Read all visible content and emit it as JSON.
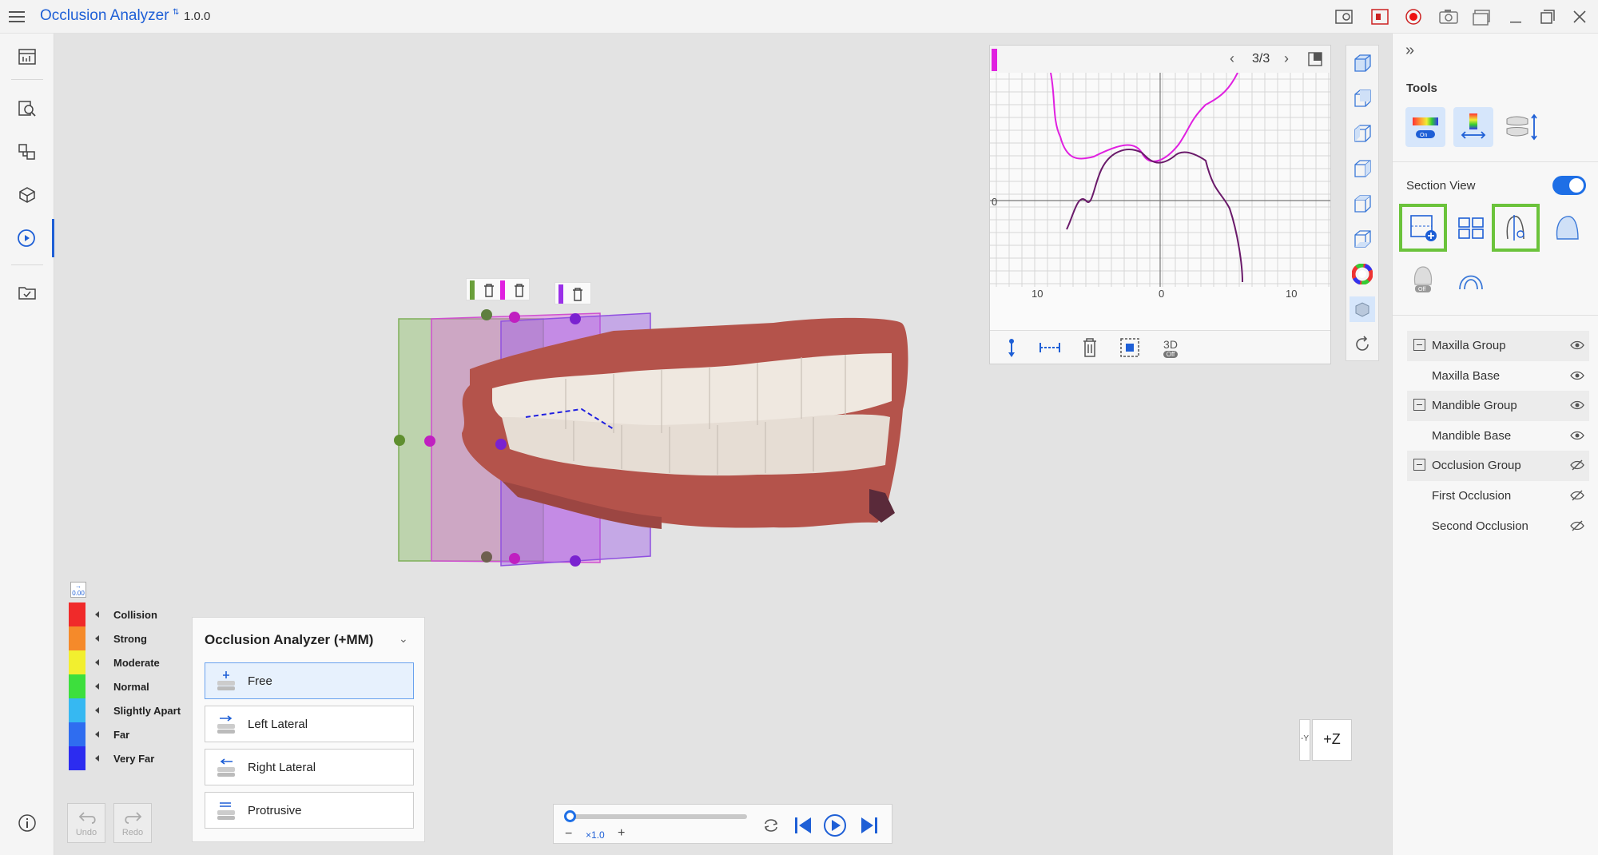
{
  "app": {
    "title": "Occlusion Analyzer",
    "version": "1.0.0"
  },
  "chart_panel": {
    "pager": "3/3",
    "x_tick_left": "10",
    "x_tick_center": "0",
    "x_tick_right": "10",
    "y_tick_zero": "0",
    "toolbar": {
      "three_d_label": "3D",
      "three_d_state": "Off"
    }
  },
  "right_panel": {
    "tools_label": "Tools",
    "tool_on_badge": "On",
    "section_view_label": "Section View",
    "section_view_enabled": true,
    "off_badge": "Off",
    "tree": [
      {
        "type": "group",
        "label": "Maxilla Group",
        "visible": true
      },
      {
        "type": "item",
        "label": "Maxilla Base",
        "visible": true
      },
      {
        "type": "group",
        "label": "Mandible Group",
        "visible": true
      },
      {
        "type": "item",
        "label": "Mandible Base",
        "visible": true
      },
      {
        "type": "group",
        "label": "Occlusion Group",
        "visible": false
      },
      {
        "type": "item",
        "label": "First Occlusion",
        "visible": false
      },
      {
        "type": "item",
        "label": "Second Occlusion",
        "visible": false
      }
    ]
  },
  "legend": {
    "reset_label": "0.00",
    "items": [
      {
        "label": "Collision",
        "color": "#f02a2a"
      },
      {
        "label": "Strong",
        "color": "#f58a2a"
      },
      {
        "label": "Moderate",
        "color": "#f2ef2f"
      },
      {
        "label": "Normal",
        "color": "#3ddf3d"
      },
      {
        "label": "Slightly Apart",
        "color": "#36b8f2"
      },
      {
        "label": "Far",
        "color": "#2f6df0"
      },
      {
        "label": "Very Far",
        "color": "#2c2cf0"
      }
    ]
  },
  "undo_label": "Undo",
  "redo_label": "Redo",
  "occlusion_panel": {
    "title": "Occlusion Analyzer (+MM)",
    "options": [
      {
        "label": "Free",
        "selected": true
      },
      {
        "label": "Left Lateral",
        "selected": false
      },
      {
        "label": "Right Lateral",
        "selected": false
      },
      {
        "label": "Protrusive",
        "selected": false
      }
    ]
  },
  "playback": {
    "speed": "×1.0",
    "minus": "−",
    "plus": "+",
    "progress": 0
  },
  "axis_widget": {
    "main": "+Z",
    "side": "-Y"
  },
  "colors": {
    "accent": "#1e5fd6",
    "highlight": "#6bc33b",
    "magenta": "#e020e0",
    "purple": "#6a1a6a"
  }
}
